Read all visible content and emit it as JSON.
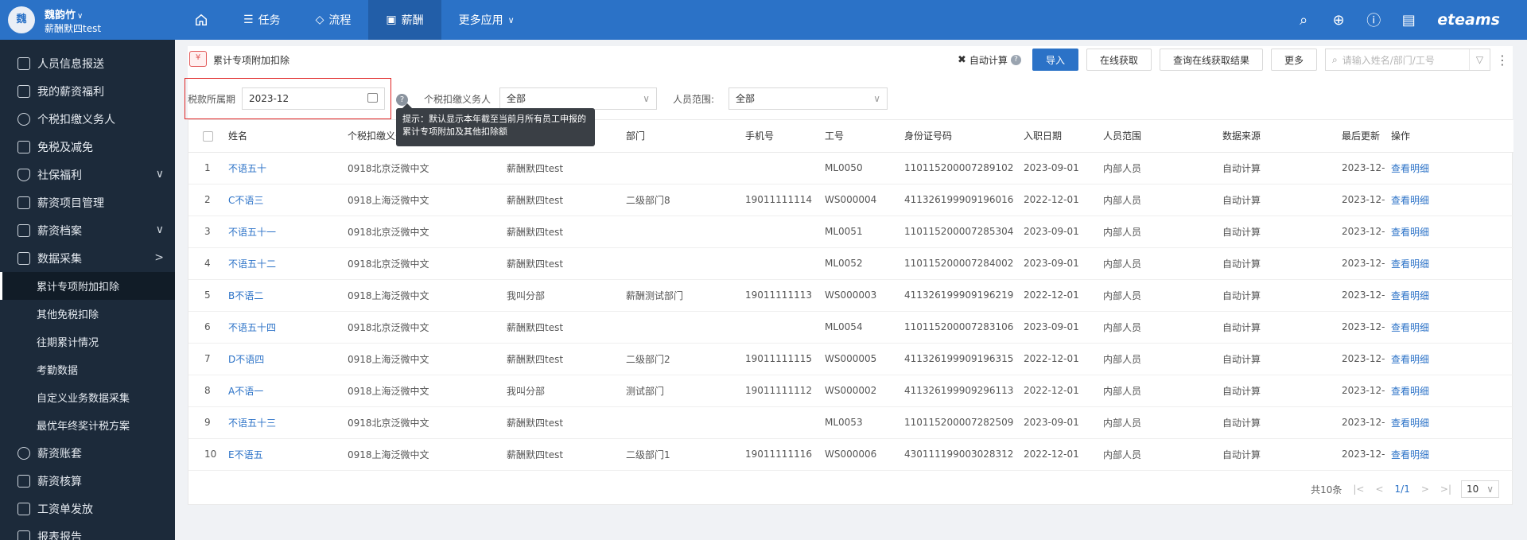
{
  "topbar": {
    "avatar_text": "魏",
    "user_name": "魏韵竹",
    "user_org": "薪酬默四test",
    "nav": [
      {
        "label": "",
        "icon": "home-icon"
      },
      {
        "label": "任务",
        "icon": "list-icon"
      },
      {
        "label": "流程",
        "icon": "layers-icon"
      },
      {
        "label": "薪酬",
        "icon": "money-icon",
        "active": true
      },
      {
        "label": "更多应用",
        "icon": "chevron-down-icon"
      }
    ],
    "brand": "eteams",
    "accent": "#2b72c7"
  },
  "sidebar": {
    "items": [
      {
        "label": "人员信息报送"
      },
      {
        "label": "我的薪资福利"
      },
      {
        "label": "个税扣缴义务人"
      },
      {
        "label": "免税及减免"
      },
      {
        "label": "社保福利",
        "chevron": "v"
      },
      {
        "label": "薪资项目管理"
      },
      {
        "label": "薪资档案",
        "chevron": "v"
      },
      {
        "label": "数据采集",
        "chevron": ">"
      }
    ],
    "subitems": [
      {
        "label": "累计专项附加扣除",
        "active": true
      },
      {
        "label": "其他免税扣除"
      },
      {
        "label": "往期累计情况"
      },
      {
        "label": "考勤数据"
      },
      {
        "label": "自定义业务数据采集"
      },
      {
        "label": "最优年终奖计税方案"
      }
    ],
    "items_after": [
      {
        "label": "薪资账套"
      },
      {
        "label": "薪资核算"
      },
      {
        "label": "工资单发放"
      },
      {
        "label": "报表报告"
      }
    ]
  },
  "page": {
    "title": "累计专项附加扣除",
    "auto_calc": "自动计算",
    "buttons": {
      "import": "导入",
      "online_fetch": "在线获取",
      "query_result": "查询在线获取结果",
      "more": "更多"
    },
    "search_placeholder": "请输入姓名/部门/工号"
  },
  "filters": {
    "period_label": "税款所属期",
    "period_value": "2023-12",
    "withholder_label": "个税扣缴义务人",
    "withholder_value": "全部",
    "scope_label": "人员范围:",
    "scope_value": "全部",
    "tooltip": "提示：默认显示本年截至当前月所有员工申报的累计专项附加及其他扣除额"
  },
  "table": {
    "headers": [
      "",
      "姓名",
      "个税扣缴义务人",
      "",
      "部门",
      "手机号",
      "工号",
      "身份证号码",
      "入职日期",
      "人员范围",
      "数据来源",
      "最后更新",
      "操作"
    ],
    "rows": [
      [
        "1",
        "不语五十",
        "0918北京泛微中文",
        "薪酬默四test",
        "",
        "",
        "ML0050",
        "110115200007289102",
        "2023-09-01",
        "内部人员",
        "自动计算",
        "2023-12-",
        "查看明细"
      ],
      [
        "2",
        "C不语三",
        "0918上海泛微中文",
        "薪酬默四test",
        "二级部门8",
        "19011111114",
        "WS000004",
        "411326199909196016",
        "2022-12-01",
        "内部人员",
        "自动计算",
        "2023-12-",
        "查看明细"
      ],
      [
        "3",
        "不语五十一",
        "0918北京泛微中文",
        "薪酬默四test",
        "",
        "",
        "ML0051",
        "110115200007285304",
        "2023-09-01",
        "内部人员",
        "自动计算",
        "2023-12-",
        "查看明细"
      ],
      [
        "4",
        "不语五十二",
        "0918北京泛微中文",
        "薪酬默四test",
        "",
        "",
        "ML0052",
        "110115200007284002",
        "2023-09-01",
        "内部人员",
        "自动计算",
        "2023-12-",
        "查看明细"
      ],
      [
        "5",
        "B不语二",
        "0918上海泛微中文",
        "我叫分部",
        "薪酬测试部门",
        "19011111113",
        "WS000003",
        "411326199909196219",
        "2022-12-01",
        "内部人员",
        "自动计算",
        "2023-12-",
        "查看明细"
      ],
      [
        "6",
        "不语五十四",
        "0918北京泛微中文",
        "薪酬默四test",
        "",
        "",
        "ML0054",
        "110115200007283106",
        "2023-09-01",
        "内部人员",
        "自动计算",
        "2023-12-",
        "查看明细"
      ],
      [
        "7",
        "D不语四",
        "0918上海泛微中文",
        "薪酬默四test",
        "二级部门2",
        "19011111115",
        "WS000005",
        "411326199909196315",
        "2022-12-01",
        "内部人员",
        "自动计算",
        "2023-12-",
        "查看明细"
      ],
      [
        "8",
        "A不语一",
        "0918上海泛微中文",
        "我叫分部",
        "测试部门",
        "19011111112",
        "WS000002",
        "411326199909296113",
        "2022-12-01",
        "内部人员",
        "自动计算",
        "2023-12-",
        "查看明细"
      ],
      [
        "9",
        "不语五十三",
        "0918北京泛微中文",
        "薪酬默四test",
        "",
        "",
        "ML0053",
        "110115200007282509",
        "2023-09-01",
        "内部人员",
        "自动计算",
        "2023-12-",
        "查看明细"
      ],
      [
        "10",
        "E不语五",
        "0918上海泛微中文",
        "薪酬默四test",
        "二级部门1",
        "19011111116",
        "WS000006",
        "430111199003028312",
        "2022-12-01",
        "内部人员",
        "自动计算",
        "2023-12-",
        "查看明细"
      ]
    ]
  },
  "pager": {
    "total": "共10条",
    "page": "1/1",
    "page_size": "10"
  }
}
